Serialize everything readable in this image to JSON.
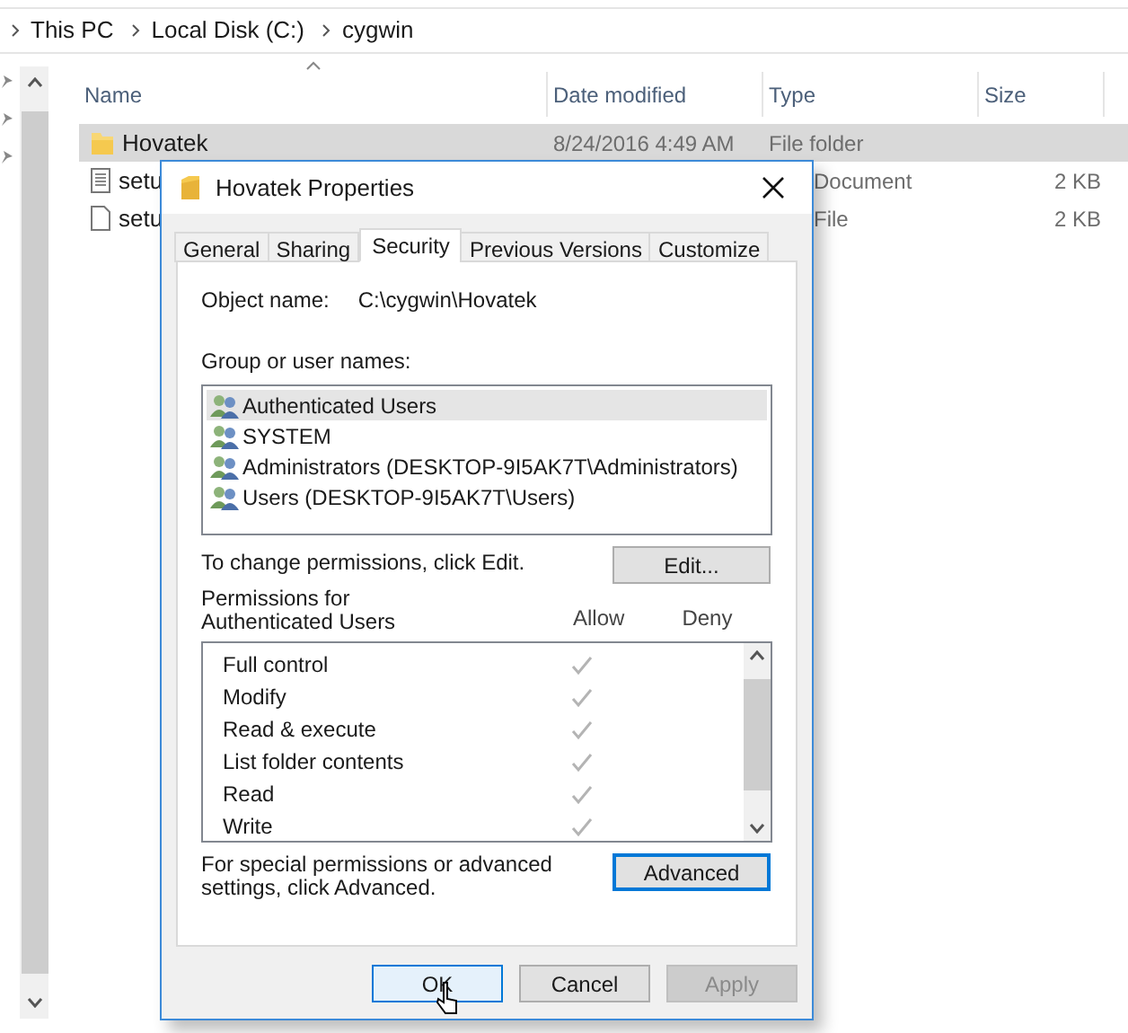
{
  "breadcrumb": [
    "This PC",
    "Local Disk (C:)",
    "cygwin"
  ],
  "file_list": {
    "columns": [
      "Name",
      "Date modified",
      "Type",
      "Size"
    ],
    "rows": [
      {
        "kind": "folder",
        "name": "Hovatek",
        "date": "8/24/2016 4:49 AM",
        "type": "File folder",
        "size": "",
        "selected": true
      },
      {
        "kind": "document",
        "name": "setu",
        "date": "",
        "type": "Document",
        "size": "2 KB",
        "selected": false
      },
      {
        "kind": "file",
        "name": "setu",
        "date": "",
        "type": "File",
        "size": "2 KB",
        "selected": false
      }
    ]
  },
  "dialog": {
    "title": "Hovatek Properties",
    "tabs": [
      {
        "label": "General",
        "selected": false
      },
      {
        "label": "Sharing",
        "selected": false
      },
      {
        "label": "Security",
        "selected": true
      },
      {
        "label": "Previous Versions",
        "selected": false
      },
      {
        "label": "Customize",
        "selected": false
      }
    ],
    "object_name_label": "Object name:",
    "object_name": "C:\\cygwin\\Hovatek",
    "group_label": "Group or user names:",
    "users": [
      {
        "name": "Authenticated Users",
        "selected": true
      },
      {
        "name": "SYSTEM",
        "selected": false
      },
      {
        "name": "Administrators (DESKTOP-9I5AK7T\\Administrators)",
        "selected": false
      },
      {
        "name": "Users (DESKTOP-9I5AK7T\\Users)",
        "selected": false
      }
    ],
    "change_hint": "To change permissions, click Edit.",
    "edit_button": "Edit...",
    "permissions_label": "Permissions for Authenticated Users",
    "allow_header": "Allow",
    "deny_header": "Deny",
    "permissions": [
      {
        "name": "Full control",
        "allow": true,
        "deny": false
      },
      {
        "name": "Modify",
        "allow": true,
        "deny": false
      },
      {
        "name": "Read & execute",
        "allow": true,
        "deny": false
      },
      {
        "name": "List folder contents",
        "allow": true,
        "deny": false
      },
      {
        "name": "Read",
        "allow": true,
        "deny": false
      },
      {
        "name": "Write",
        "allow": true,
        "deny": false
      }
    ],
    "advanced_hint": "For special permissions or advanced settings, click Advanced.",
    "advanced_button": "Advanced",
    "buttons": [
      {
        "label": "OK",
        "disabled": false,
        "focused": true
      },
      {
        "label": "Cancel",
        "disabled": false,
        "focused": false
      },
      {
        "label": "Apply",
        "disabled": true,
        "focused": false
      }
    ]
  }
}
